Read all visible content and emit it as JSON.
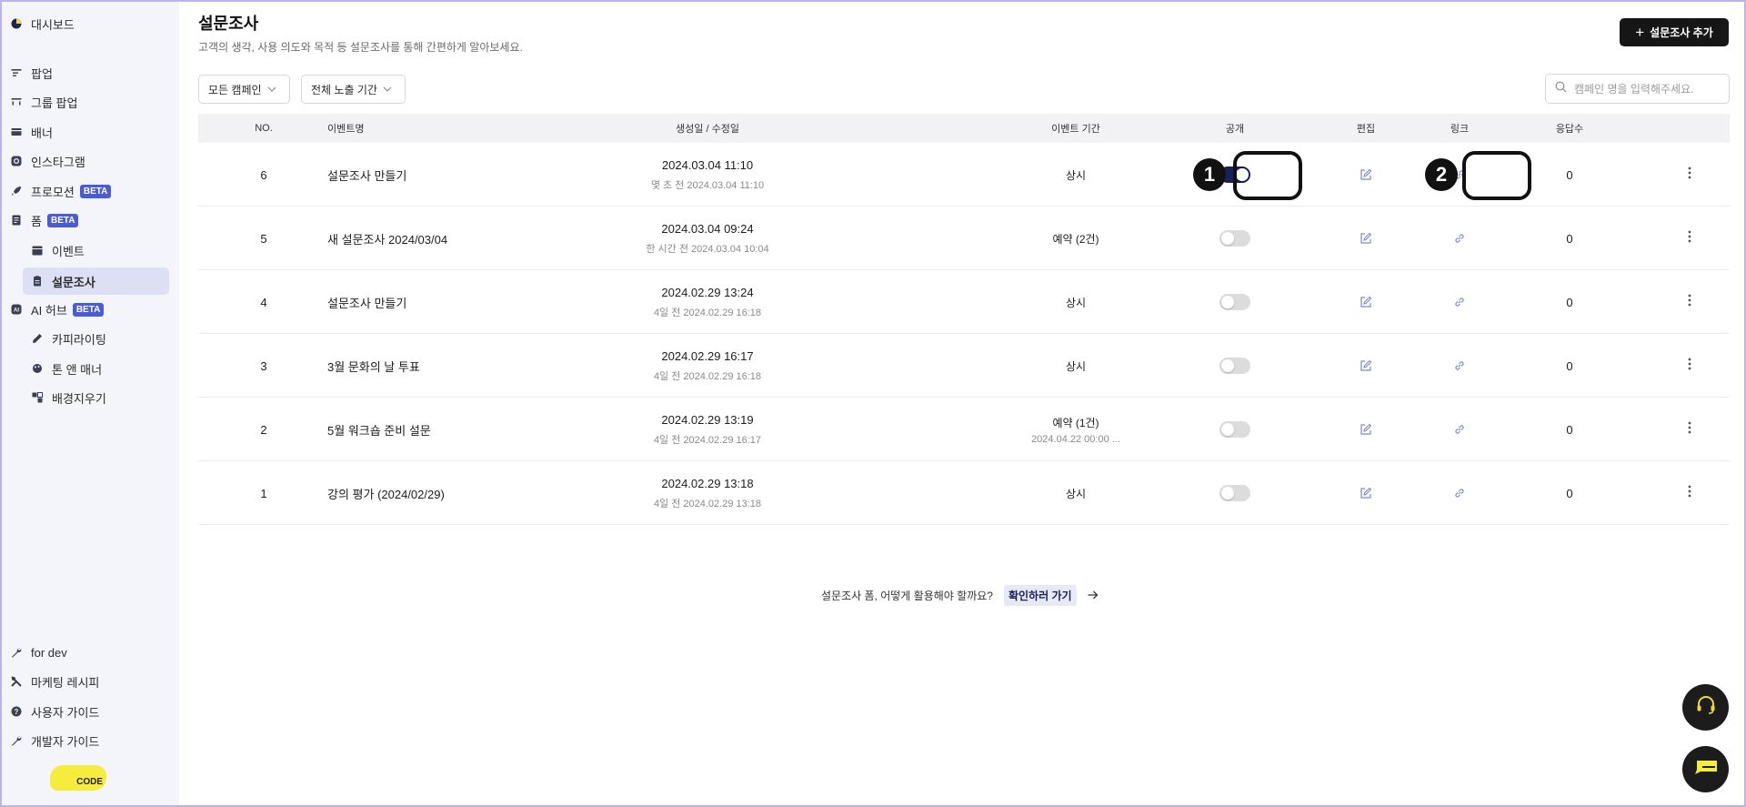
{
  "sidebar": {
    "items": [
      {
        "label": "대시보드",
        "icon": "pie-chart-icon"
      },
      {
        "label": "팝업",
        "icon": "popup-icon"
      },
      {
        "label": "그룹 팝업",
        "icon": "group-popup-icon"
      },
      {
        "label": "배너",
        "icon": "banner-icon"
      },
      {
        "label": "인스타그램",
        "icon": "instagram-icon"
      },
      {
        "label": "프로모션",
        "icon": "rocket-icon",
        "badge": "BETA"
      },
      {
        "label": "폼",
        "icon": "form-icon",
        "badge": "BETA"
      },
      {
        "label": "이벤트",
        "icon": "event-icon"
      },
      {
        "label": "설문조사",
        "icon": "survey-icon"
      },
      {
        "label": "AI 허브",
        "icon": "ai-icon",
        "badge": "BETA"
      },
      {
        "label": "카피라이팅",
        "icon": "pen-icon"
      },
      {
        "label": "톤 앤 매너",
        "icon": "palette-icon"
      },
      {
        "label": "배경지우기",
        "icon": "eraser-icon"
      }
    ],
    "bottom": [
      {
        "label": "for dev",
        "icon": "wrench-icon"
      },
      {
        "label": "마케팅 레시피",
        "icon": "recipe-icon"
      },
      {
        "label": "사용자 가이드",
        "icon": "help-icon"
      },
      {
        "label": "개발자 가이드",
        "icon": "wrench-icon"
      }
    ],
    "logo_text": "CODE"
  },
  "header": {
    "title": "설문조사",
    "subtitle": "고객의 생각, 사용 의도와 목적 등 설문조사를 통해 간편하게 알아보세요.",
    "add_button": "설문조사 추가"
  },
  "filters": {
    "campaign": "모든 캠페인",
    "period": "전체 노출 기간"
  },
  "search": {
    "placeholder": "캠페인 명을 입력해주세요."
  },
  "table": {
    "columns": [
      "NO.",
      "이벤트명",
      "생성일 / 수정일",
      "이벤트 기간",
      "공개",
      "편집",
      "링크",
      "응답수"
    ],
    "rows": [
      {
        "no": "6",
        "name": "설문조사 만들기",
        "created": "2024.03.04 11:10",
        "modified": "몇 초 전 2024.03.04 11:10",
        "period": "상시",
        "period_sub": "",
        "public": true,
        "responses": "0"
      },
      {
        "no": "5",
        "name": "새 설문조사 2024/03/04",
        "created": "2024.03.04 09:24",
        "modified": "한 시간 전 2024.03.04 10:04",
        "period": "예약 (2건)",
        "period_sub": "",
        "public": false,
        "responses": "0"
      },
      {
        "no": "4",
        "name": "설문조사 만들기",
        "created": "2024.02.29 13:24",
        "modified": "4일 전 2024.02.29 16:18",
        "period": "상시",
        "period_sub": "",
        "public": false,
        "responses": "0"
      },
      {
        "no": "3",
        "name": "3월 문화의 날 투표",
        "created": "2024.02.29 16:17",
        "modified": "4일 전 2024.02.29 16:18",
        "period": "상시",
        "period_sub": "",
        "public": false,
        "responses": "0"
      },
      {
        "no": "2",
        "name": "5월 워크숍 준비 설문",
        "created": "2024.02.29 13:19",
        "modified": "4일 전 2024.02.29 16:17",
        "period": "예약 (1건)",
        "period_sub": "2024.04.22 00:00 ...",
        "public": false,
        "responses": "0"
      },
      {
        "no": "1",
        "name": "강의 평가 (2024/02/29)",
        "created": "2024.02.29 13:18",
        "modified": "4일 전 2024.02.29 13:18",
        "period": "상시",
        "period_sub": "",
        "public": false,
        "responses": "0"
      }
    ]
  },
  "annotations": [
    "1",
    "2"
  ],
  "tip": {
    "text": "설문조사 폼, 어떻게 활용해야 할까요?",
    "link": "확인하러 가기"
  },
  "colors": {
    "accent": "#1b1f5a",
    "beta": "#4a5bd6",
    "sidebar_bg": "#f4f5fb",
    "active_bg": "#dde0f5",
    "logo": "#f5ec3d"
  }
}
